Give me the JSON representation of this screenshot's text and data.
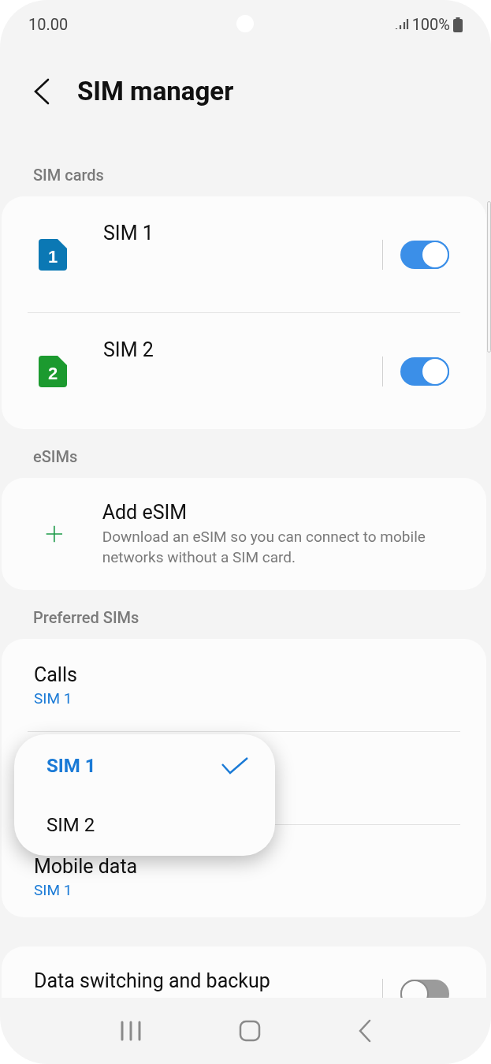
{
  "status_bar": {
    "time": "10.00",
    "battery": "100%"
  },
  "header": {
    "title": "SIM manager"
  },
  "sections": [
    {
      "label": "SIM cards",
      "items": [
        {
          "kind": "sim",
          "badge": "1",
          "color": "#0b78b4",
          "title": "SIM 1",
          "on": true
        },
        {
          "kind": "sim",
          "badge": "2",
          "color": "#1c9a2f",
          "title": "SIM 2",
          "on": true
        }
      ]
    },
    {
      "label": "eSIMs",
      "items": [
        {
          "kind": "add",
          "title": "Add eSIM",
          "subtitle": "Download an eSIM so you can connect to mobile networks without a SIM card."
        }
      ]
    },
    {
      "label": "Preferred SIMs",
      "items": [
        {
          "kind": "value",
          "title": "Calls",
          "value": "SIM 1"
        },
        {
          "kind": "covered"
        },
        {
          "kind": "value",
          "title": "Mobile data",
          "value": "SIM 1"
        }
      ]
    },
    {
      "items": [
        {
          "kind": "toggle",
          "title": "Data switching and backup",
          "on": false
        }
      ]
    }
  ],
  "popup": {
    "options": [
      {
        "label": "SIM 1",
        "selected": true
      },
      {
        "label": "SIM 2",
        "selected": false
      }
    ]
  }
}
